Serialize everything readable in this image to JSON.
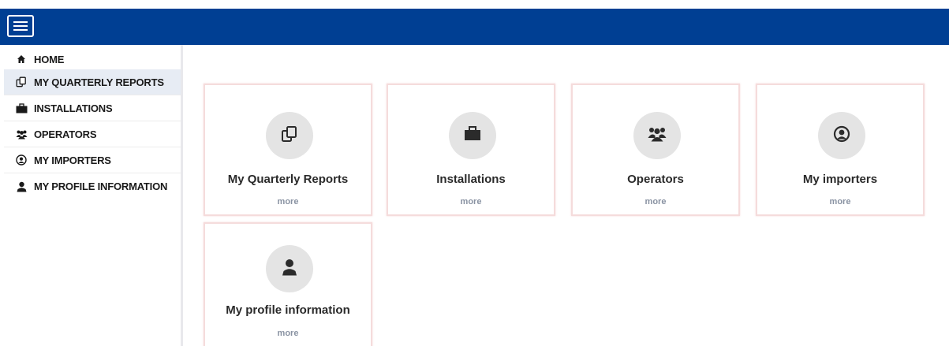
{
  "header": {
    "menu_icon": "hamburger-menu-icon",
    "background_color": "#003f93"
  },
  "sidebar": {
    "items": [
      {
        "label": "HOME",
        "icon": "home-icon"
      },
      {
        "label": "MY QUARTERLY REPORTS",
        "icon": "copy-documents-icon",
        "active": true
      },
      {
        "label": "INSTALLATIONS",
        "icon": "briefcase-icon"
      },
      {
        "label": "OPERATORS",
        "icon": "users-icon"
      },
      {
        "label": "MY IMPORTERS",
        "icon": "user-circle-icon"
      },
      {
        "label": "MY PROFILE INFORMATION",
        "icon": "user-icon"
      }
    ]
  },
  "cards": [
    {
      "title": "My Quarterly Reports",
      "more": "more",
      "icon": "copy-documents-icon"
    },
    {
      "title": "Installations",
      "more": "more",
      "icon": "briefcase-icon"
    },
    {
      "title": "Operators",
      "more": "more",
      "icon": "users-icon"
    },
    {
      "title": "My importers",
      "more": "more",
      "icon": "user-circle-icon"
    },
    {
      "title": "My profile information",
      "more": "more",
      "icon": "user-icon"
    }
  ],
  "colors": {
    "accent": "#003f93",
    "active_item": "#e7ecf4",
    "card_border": "#f5dcdc",
    "more_text": "#8a93a3"
  }
}
